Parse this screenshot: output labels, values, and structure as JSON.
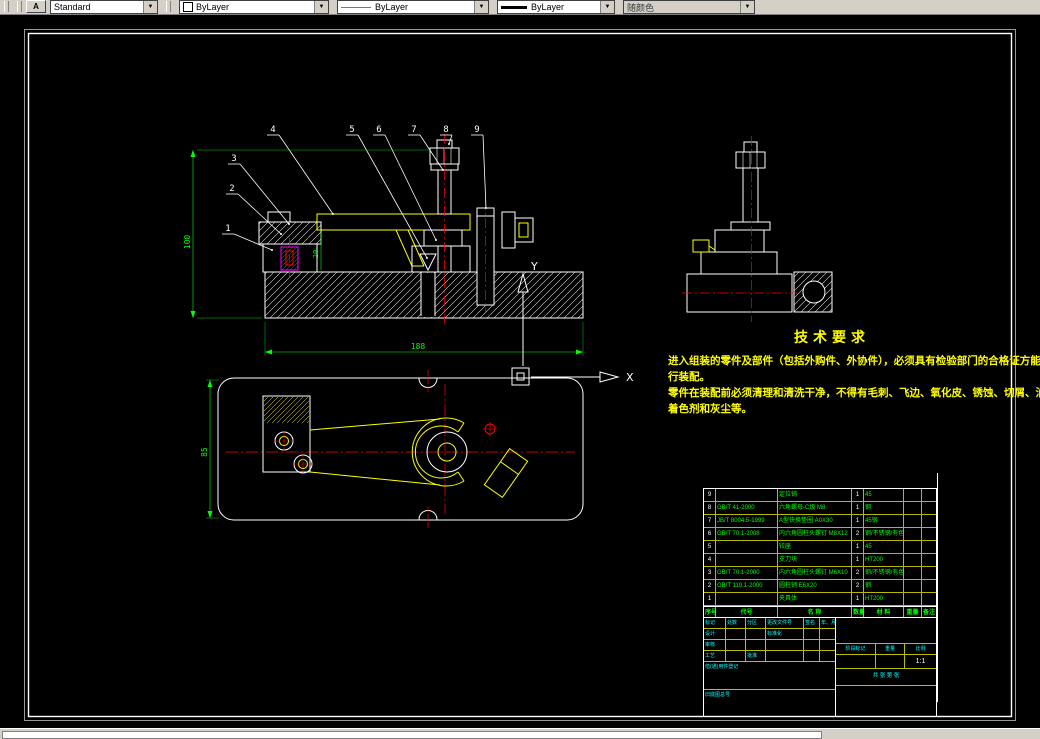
{
  "toolbar": {
    "style_value": "Standard",
    "color_value": "ByLayer",
    "linetype_value": "ByLayer",
    "lineweight_value": "ByLayer",
    "plotstyle_value": "随颜色"
  },
  "drawing": {
    "balloons": [
      "1",
      "2",
      "3",
      "4",
      "5",
      "6",
      "7",
      "8",
      "9"
    ],
    "dimensions": {
      "front_height": "100",
      "front_width": "188",
      "arm_gap": "20",
      "plan_height": "85"
    },
    "ucs": {
      "x": "X",
      "y": "Y"
    },
    "colors": {
      "outline": "#ffffff",
      "detail": "#ffff00",
      "centerline": "#ff0000",
      "dimension": "#00ff00",
      "bushing": "#ff00ff"
    }
  },
  "tech_requirements": {
    "title": "技术要求",
    "lines": [
      {
        "text": "进入组装的零件及部件（包括外购件、外协件），必须具有检验部门的合格证方能进"
      },
      {
        "text": "行装配。"
      },
      {
        "text": "零件在装配前必须清理和清洗干净，不得有毛刺、飞边、氧化皮、锈蚀、切屑、油污、"
      },
      {
        "text": "着色剂和灰尘等。"
      }
    ]
  },
  "parts_table": {
    "headers": {
      "no": "序号",
      "code": "代号",
      "name": "名  称",
      "qty": "数量",
      "mat": "材  料",
      "wt": "重量",
      "rk": "备注"
    },
    "rows": [
      {
        "no": "9",
        "code": "",
        "name": "定位销",
        "qty": "1",
        "mat": "45",
        "wt": "",
        "rk": ""
      },
      {
        "no": "8",
        "code": "GB/T 41-2000",
        "name": "六角螺母-C级 M8",
        "qty": "1",
        "mat": "钢",
        "wt": "",
        "rk": ""
      },
      {
        "no": "7",
        "code": "JB/T 8004.5-1999",
        "name": "A型快换垫圈 A0X30",
        "qty": "1",
        "mat": "45钢",
        "wt": "",
        "rk": ""
      },
      {
        "no": "6",
        "code": "GB/T 70.1-2008",
        "name": "内六角圆柱头螺钉 M8X12",
        "qty": "2",
        "mat": "钢/不锈钢/有色金属",
        "wt": "",
        "rk": ""
      },
      {
        "no": "5",
        "code": "",
        "name": "铰座",
        "qty": "1",
        "mat": "45",
        "wt": "",
        "rk": ""
      },
      {
        "no": "4",
        "code": "",
        "name": "支刀块",
        "qty": "1",
        "mat": "HT200",
        "wt": "",
        "rk": ""
      },
      {
        "no": "3",
        "code": "GB/T 70.1-2000",
        "name": "内六角圆柱头螺钉 M6X10",
        "qty": "2",
        "mat": "钢/不锈钢/有色金属",
        "wt": "",
        "rk": ""
      },
      {
        "no": "2",
        "code": "GB/T 119.1-2000",
        "name": "圆柱销 E6X20",
        "qty": "2",
        "mat": "钢",
        "wt": "",
        "rk": ""
      },
      {
        "no": "1",
        "code": "",
        "name": "夹具体",
        "qty": "1",
        "mat": "HT200",
        "wt": "",
        "rk": ""
      }
    ]
  },
  "title_block": {
    "revision_headers": [
      "标记",
      "处数",
      "分区",
      "更改文件号",
      "签名",
      "年、月、日"
    ],
    "design": "设计",
    "standardization": "标准化",
    "check": "审核",
    "process": "工艺",
    "approve": "批准",
    "stage": "阶段标记",
    "weight": "重量",
    "scale": "比例",
    "scale_value": "1:1",
    "sheets": "共 张 第 张",
    "borrow": "借(通)用件登记",
    "old_base": "旧底图总号"
  }
}
